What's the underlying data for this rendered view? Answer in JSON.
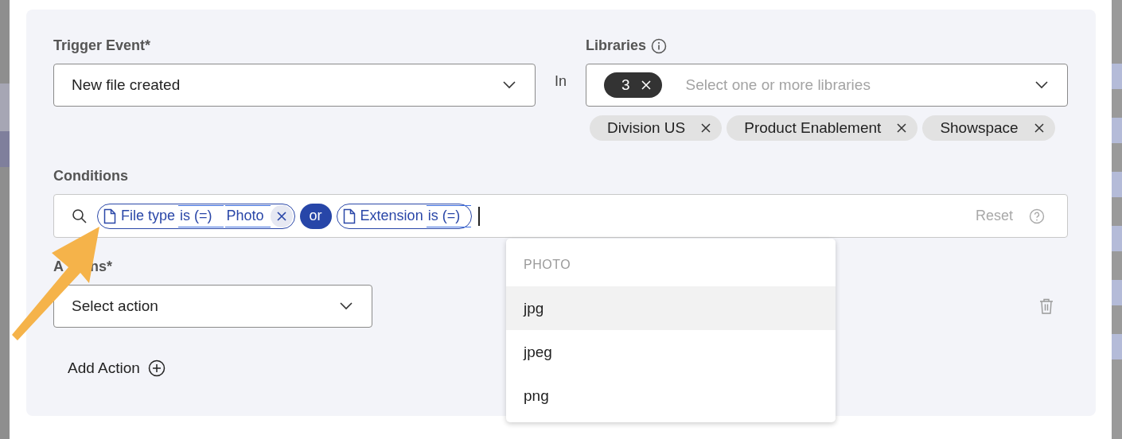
{
  "trigger": {
    "label": "Trigger Event*",
    "value": "New file created"
  },
  "in_label": "In",
  "libraries": {
    "label": "Libraries",
    "count": "3",
    "placeholder": "Select one or more libraries",
    "chips": [
      "Division US",
      "Product Enablement",
      "Showspace"
    ]
  },
  "conditions": {
    "label": "Conditions",
    "reset": "Reset",
    "tokens": [
      {
        "kind": "filter",
        "field": "File type",
        "operator": "is (=)",
        "value": "Photo"
      },
      {
        "kind": "join",
        "label": "or"
      },
      {
        "kind": "filter",
        "field": "Extension",
        "operator": "is (=)"
      }
    ]
  },
  "actions": {
    "label_fragments": [
      "A",
      "ns*"
    ],
    "placeholder": "Select action",
    "add": "Add Action"
  },
  "dropdown": {
    "group": "PHOTO",
    "options": [
      {
        "label": "jpg",
        "selected": true
      },
      {
        "label": "jpeg",
        "selected": false
      },
      {
        "label": "png",
        "selected": false
      }
    ]
  }
}
